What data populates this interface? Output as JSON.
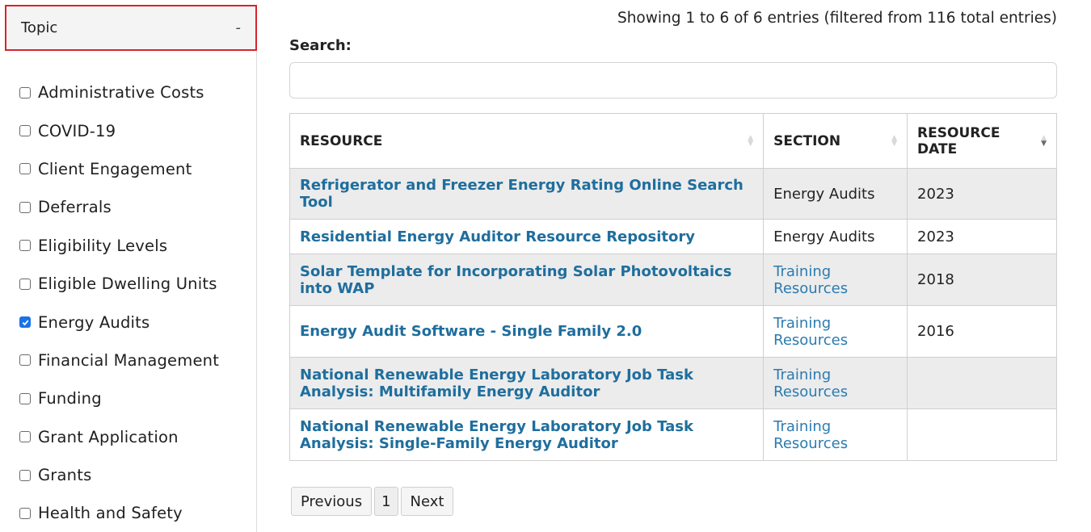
{
  "sidebar": {
    "header_label": "Topic",
    "toggle_symbol": "-",
    "items": [
      {
        "label": "Administrative Costs",
        "checked": false
      },
      {
        "label": "COVID-19",
        "checked": false
      },
      {
        "label": "Client Engagement",
        "checked": false
      },
      {
        "label": "Deferrals",
        "checked": false
      },
      {
        "label": "Eligibility Levels",
        "checked": false
      },
      {
        "label": "Eligible Dwelling Units",
        "checked": false
      },
      {
        "label": "Energy Audits",
        "checked": true
      },
      {
        "label": "Financial Management",
        "checked": false
      },
      {
        "label": "Funding",
        "checked": false
      },
      {
        "label": "Grant Application",
        "checked": false
      },
      {
        "label": "Grants",
        "checked": false
      },
      {
        "label": "Health and Safety",
        "checked": false
      }
    ]
  },
  "table_info": "Showing 1 to 6 of 6 entries (filtered from 116 total entries)",
  "search": {
    "label": "Search:",
    "value": "",
    "placeholder": ""
  },
  "table": {
    "headers": [
      "RESOURCE",
      "SECTION",
      "RESOURCE DATE"
    ],
    "rows": [
      {
        "resource": "Refrigerator and Freezer Energy Rating Online Search Tool",
        "section": "Energy Audits",
        "section_link": false,
        "date": "2023"
      },
      {
        "resource": "Residential Energy Auditor Resource Repository",
        "section": "Energy Audits",
        "section_link": false,
        "date": "2023"
      },
      {
        "resource": "Solar Template for Incorporating Solar Photovoltaics into WAP",
        "section": "Training Resources",
        "section_link": true,
        "date": "2018"
      },
      {
        "resource": "Energy Audit Software - Single Family 2.0",
        "section": "Training Resources",
        "section_link": true,
        "date": "2016"
      },
      {
        "resource": "National Renewable Energy Laboratory Job Task Analysis: Multifamily Energy Auditor",
        "section": "Training Resources",
        "section_link": true,
        "date": ""
      },
      {
        "resource": "National Renewable Energy Laboratory Job Task Analysis: Single-Family Energy Auditor",
        "section": "Training Resources",
        "section_link": true,
        "date": ""
      }
    ]
  },
  "pagination": {
    "previous": "Previous",
    "current": "1",
    "next": "Next"
  },
  "colors": {
    "accent_border": "#d9232d",
    "link": "#1f6e9d",
    "checkbox_checked": "#1a73e8"
  }
}
